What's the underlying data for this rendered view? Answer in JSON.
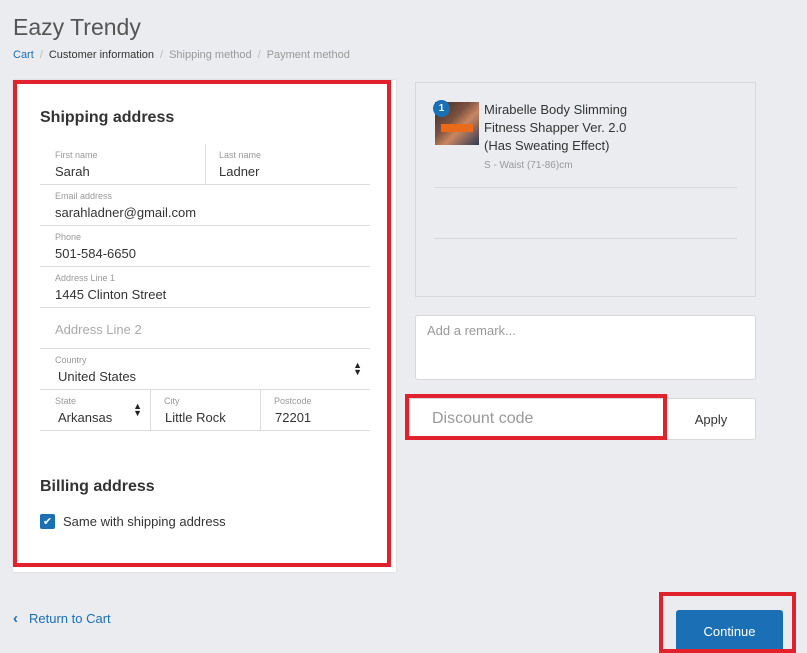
{
  "store": {
    "title": "Eazy Trendy"
  },
  "breadcrumb": [
    {
      "label": "Cart"
    },
    {
      "label": "Customer information"
    },
    {
      "label": "Shipping method"
    },
    {
      "label": "Payment method"
    }
  ],
  "shipping": {
    "title": "Shipping address",
    "first_name": {
      "label": "First name",
      "value": "Sarah"
    },
    "last_name": {
      "label": "Last name",
      "value": "Ladner"
    },
    "email": {
      "label": "Email address",
      "value": "sarahladner@gmail.com"
    },
    "phone": {
      "label": "Phone",
      "value": "501-584-6650"
    },
    "address1": {
      "label": "Address Line 1",
      "value": "1445 Clinton Street"
    },
    "address2": {
      "placeholder": "Address Line 2"
    },
    "country": {
      "label": "Country",
      "value": "United States"
    },
    "state": {
      "label": "State",
      "value": "Arkansas"
    },
    "city": {
      "label": "City",
      "value": "Little Rock"
    },
    "postcode": {
      "label": "Postcode",
      "value": "72201"
    }
  },
  "billing": {
    "title": "Billing address",
    "same_label": "Same with shipping address",
    "same_checked": true
  },
  "order": {
    "quantity": "1",
    "product_name": "Mirabelle Body Slimming Fitness Shapper Ver. 2.0 (Has Sweating Effect)",
    "variant": "S - Waist (71-86)cm"
  },
  "remark": {
    "placeholder": "Add a remark..."
  },
  "discount": {
    "placeholder": "Discount code",
    "apply_label": "Apply"
  },
  "footer": {
    "return_label": "Return to Cart",
    "continue_label": "Continue"
  },
  "colors": {
    "accent": "#1a6fb5",
    "highlight": "#e1222c",
    "background": "#ebecf0"
  }
}
